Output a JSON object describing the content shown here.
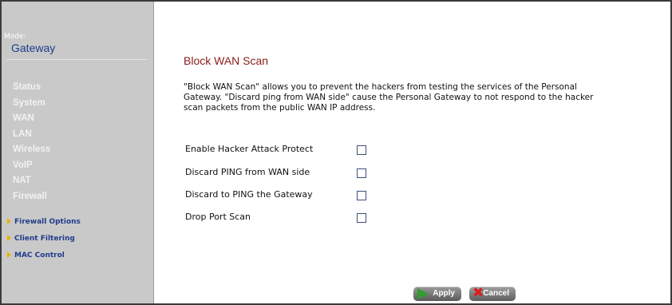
{
  "sidebar": {
    "mode_label": "Mode:",
    "mode_value": "Gateway",
    "nav_items": [
      "Status",
      "System",
      "WAN",
      "LAN",
      "Wireless",
      "VoIP",
      "NAT",
      "Firewall"
    ],
    "sub_items": [
      "Firewall Options",
      "Client Filtering",
      "MAC Control"
    ]
  },
  "main": {
    "title": "Block WAN Scan",
    "description": "\"Block WAN Scan\" allows you to prevent the hackers from testing the services of the Personal Gateway. \"Discard ping from WAN side\" cause the Personal Gateway to not respond to the hacker scan packets from the public WAN IP address.",
    "options": [
      {
        "label": "Enable Hacker Attack Protect",
        "checked": false
      },
      {
        "label": "Discard PING from WAN side",
        "checked": false
      },
      {
        "label": "Discard to PING the Gateway",
        "checked": false
      },
      {
        "label": "Drop Port Scan",
        "checked": false
      }
    ],
    "buttons": {
      "apply": "Apply",
      "cancel": "Cancel"
    }
  },
  "colors": {
    "sidebar_bg": "#c9c9c9",
    "title": "#8b1a1a",
    "mode_value": "#1f3c8a",
    "submenu_text": "#1f3c8a",
    "submenu_arrow": "#e9b400",
    "apply_icon": "#2e9e2e",
    "cancel_icon": "#d72020"
  },
  "icons": {
    "submenu": "triangle-right-icon",
    "apply": "green-arrow-icon",
    "cancel": "red-x-icon"
  }
}
